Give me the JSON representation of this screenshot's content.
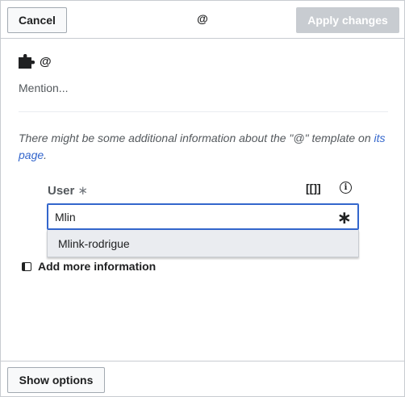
{
  "header": {
    "cancel_label": "Cancel",
    "title": "@",
    "apply_label": "Apply changes"
  },
  "template": {
    "icon": "puzzle-icon",
    "name": "@",
    "description": "Mention..."
  },
  "note": {
    "text_before": "There might be some additional information about the \"@\" template on ",
    "link_text": "its page",
    "text_after": "."
  },
  "parameter": {
    "label": "User",
    "required_marker": "∗",
    "wikitext_icon_label": "[[]]",
    "info_icon": "i",
    "value": "Mlin",
    "field_marker": "∗"
  },
  "suggestions": [
    "Mlink-rodrigue"
  ],
  "add_more_label": "Add more information",
  "footer": {
    "show_options_label": "Show options"
  },
  "colors": {
    "accent": "#3366cc",
    "disabled": "#c8ccd1",
    "border": "#a2a9b1"
  }
}
